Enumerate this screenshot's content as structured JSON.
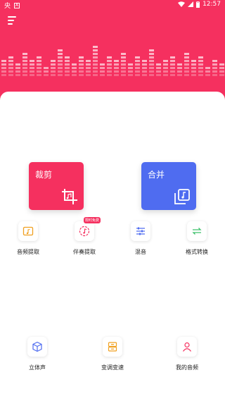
{
  "colors": {
    "brand": "#f5305f",
    "merge_blue": "#4f6cf0",
    "accent_orange": "#f0a020",
    "accent_green": "#3cc06a"
  },
  "status_bar": {
    "app_glyph": "央",
    "time": "12:57"
  },
  "header": {
    "menu_icon": "hamburger-menu-icon"
  },
  "main_cards": [
    {
      "label": "裁剪",
      "icon": "crop-icon"
    },
    {
      "label": "合并",
      "icon": "merge-music-icon"
    }
  ],
  "tools_row1": [
    {
      "label": "音频提取",
      "icon": "audio-extract-icon"
    },
    {
      "label": "伴奏提取",
      "icon": "accompaniment-icon",
      "badge": "限时免费"
    },
    {
      "label": "混音",
      "icon": "mixer-icon"
    },
    {
      "label": "格式转换",
      "icon": "format-convert-icon"
    }
  ],
  "tools_row2": [
    {
      "label": "立体声",
      "icon": "stereo-cube-icon"
    },
    {
      "label": "变调变速",
      "icon": "pitch-speed-icon"
    },
    {
      "label": "我的音频",
      "icon": "my-audio-user-icon"
    }
  ]
}
